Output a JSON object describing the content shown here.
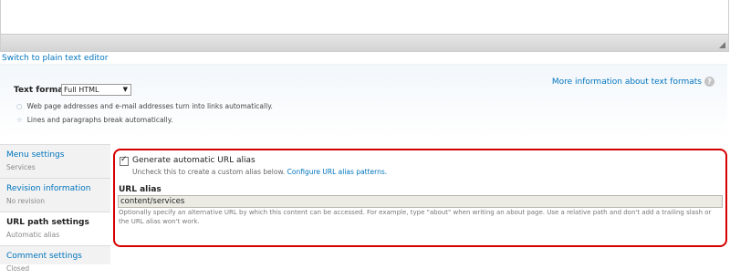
{
  "editor": {
    "switch_link": "Switch to plain text editor"
  },
  "text_format": {
    "label": "Text format",
    "selected": "Full HTML",
    "more_info": "More information about text formats",
    "tips": [
      "Web page addresses and e-mail addresses turn into links automatically.",
      "Lines and paragraphs break automatically."
    ]
  },
  "vertical_tabs": [
    {
      "title": "Menu settings",
      "summary": "Services"
    },
    {
      "title": "Revision information",
      "summary": "No revision"
    },
    {
      "title": "URL path settings",
      "summary": "Automatic alias"
    },
    {
      "title": "Comment settings",
      "summary": "Closed"
    }
  ],
  "url_path": {
    "checkbox_label": "Generate automatic URL alias",
    "checkbox_checked": true,
    "checkbox_desc": "Uncheck this to create a custom alias below.",
    "checkbox_link": "Configure URL alias patterns.",
    "alias_label": "URL alias",
    "alias_value": "content/services",
    "alias_desc": "Optionally specify an alternative URL by which this content can be accessed. For example, type \"about\" when writing an about page. Use a relative path and don't add a trailing slash or the URL alias won't work."
  },
  "colors": {
    "link": "#0074bd",
    "highlight_outline": "#d60000"
  }
}
